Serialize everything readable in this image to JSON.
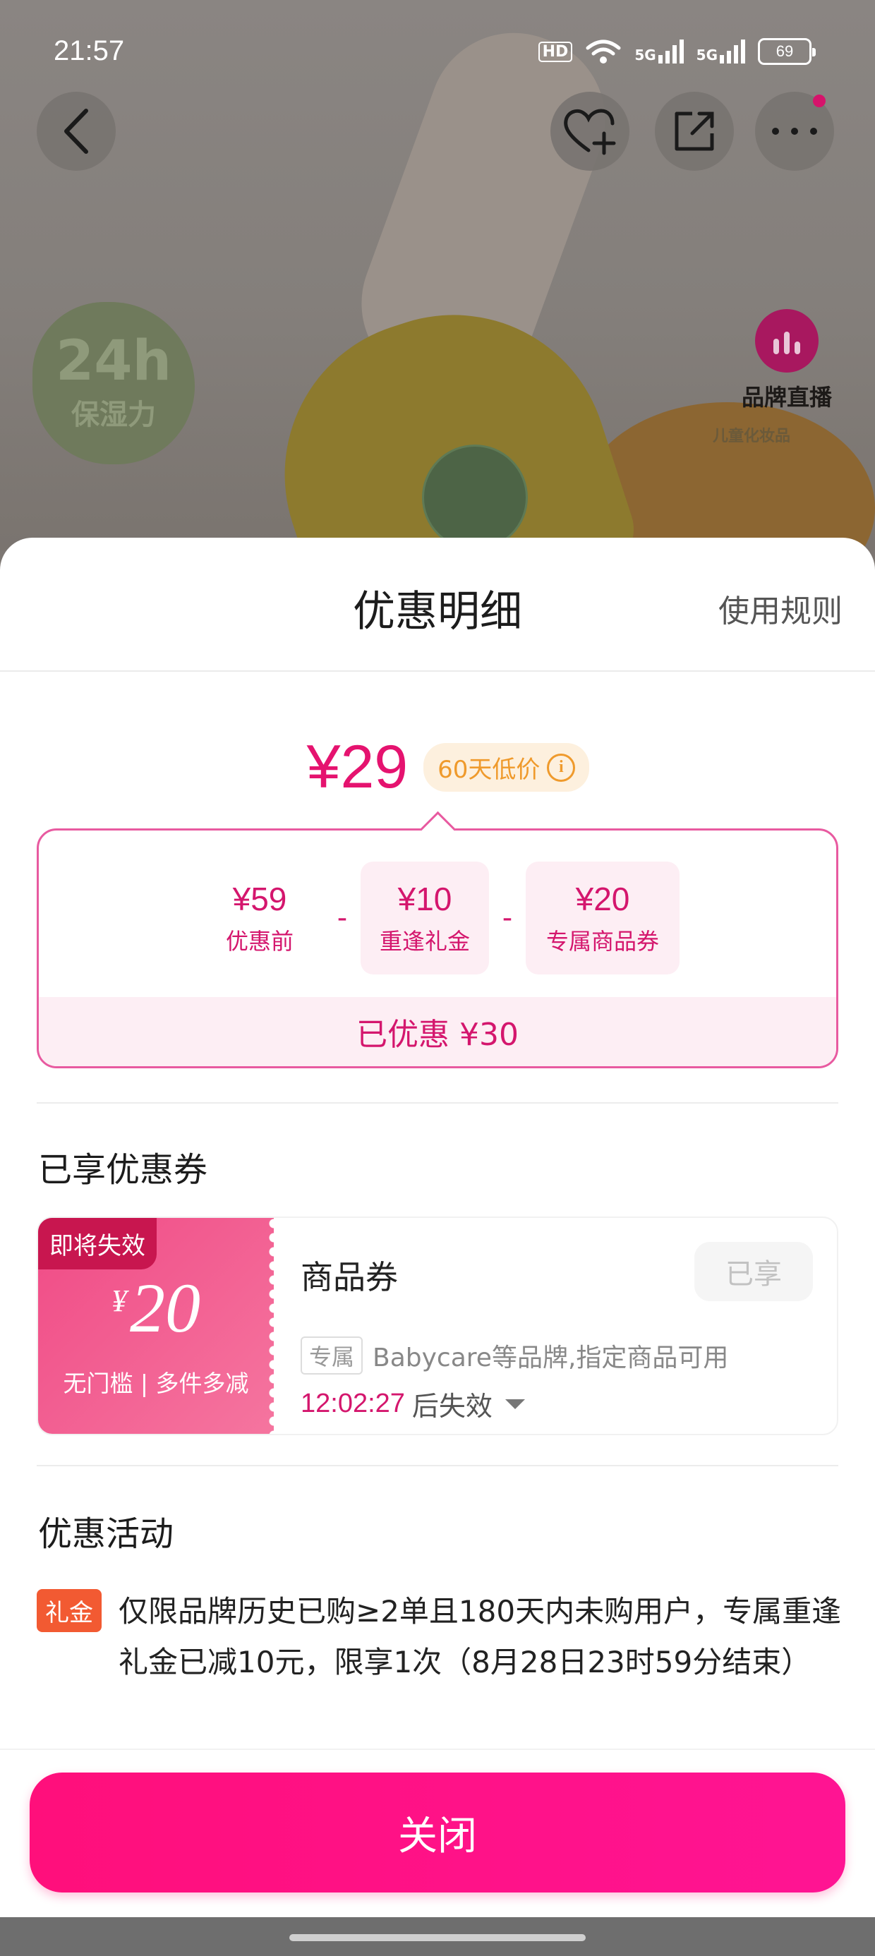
{
  "status_bar": {
    "time": "21:57",
    "hd_label": "HD",
    "network_1": "5G",
    "network_2": "5G",
    "battery": "69"
  },
  "product_bg": {
    "badge_big": "24h",
    "badge_small": "保湿力",
    "live_label": "品牌直播",
    "brand_caption": "儿童化妆品"
  },
  "sheet": {
    "title": "优惠明细",
    "rules_link": "使用规则",
    "final_price": "¥29",
    "low_price_tag": "60天低价",
    "breakdown": {
      "items": [
        {
          "amount": "¥59",
          "label": "优惠前"
        },
        {
          "amount": "¥10",
          "label": "重逢礼金"
        },
        {
          "amount": "¥20",
          "label": "专属商品券"
        }
      ],
      "minus": "-",
      "total": "已优惠 ¥30"
    },
    "coupon_section_title": "已享优惠券",
    "coupon": {
      "expire_tag": "即将失效",
      "currency": "¥",
      "amount": "20",
      "condition": "无门槛 | 多件多减",
      "name": "商品券",
      "status_button": "已享",
      "scope_tag": "专属",
      "scope_desc": "Babycare等品牌,指定商品可用",
      "countdown": "12:02:27",
      "countdown_suffix": "后失效"
    },
    "activity_section_title": "优惠活动",
    "activity": {
      "tag": "礼金",
      "text": "仅限品牌历史已购≥2单且180天内未购用户，专属重逢礼金已减10元，限享1次（8月28日23时59分结束）"
    },
    "close_button": "关闭"
  },
  "colors": {
    "accent": "#e5136f",
    "close_button": "#ff0f7b",
    "low_price_tag": "#ef9a2c",
    "promo_tag": "#f25a32"
  }
}
